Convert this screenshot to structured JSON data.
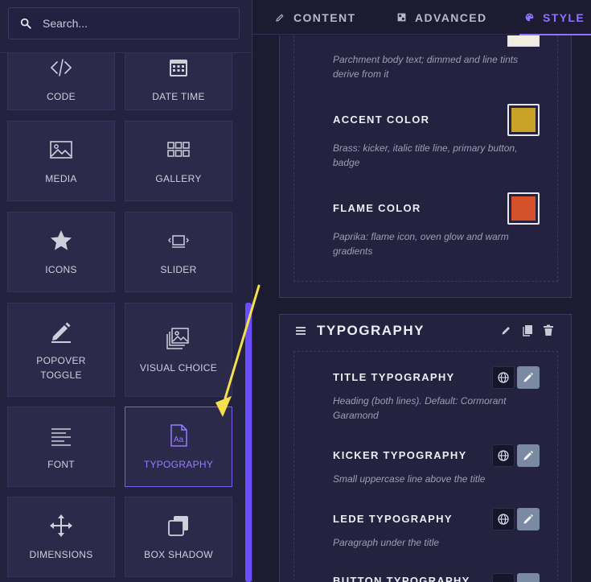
{
  "search": {
    "placeholder": "Search..."
  },
  "widgets": [
    {
      "label": "CODE",
      "icon": "code-icon"
    },
    {
      "label": "DATE TIME",
      "icon": "calendar-icon"
    },
    {
      "label": "MEDIA",
      "icon": "image-icon"
    },
    {
      "label": "GALLERY",
      "icon": "gallery-icon"
    },
    {
      "label": "ICONS",
      "icon": "star-icon"
    },
    {
      "label": "SLIDER",
      "icon": "slider-icon"
    },
    {
      "label": "POPOVER",
      "label2": "TOGGLE",
      "icon": "pencil-icon"
    },
    {
      "label": "VISUAL CHOICE",
      "icon": "images-stack-icon"
    },
    {
      "label": "FONT",
      "icon": "text-lines-icon"
    },
    {
      "label": "TYPOGRAPHY",
      "icon": "typography-icon",
      "active": true
    },
    {
      "label": "DIMENSIONS",
      "icon": "move-arrows-icon"
    },
    {
      "label": "BOX SHADOW",
      "icon": "box-shadow-icon"
    }
  ],
  "tabs": [
    {
      "label": "CONTENT",
      "icon": "pencil-icon"
    },
    {
      "label": "ADVANCED",
      "icon": "grid-icon"
    },
    {
      "label": "STYLE",
      "icon": "palette-icon",
      "active": true
    }
  ],
  "colors_section": {
    "partial_desc": "Parchment body text; dimmed and line tints derive from it",
    "fields": [
      {
        "label": "ACCENT COLOR",
        "desc": "Brass: kicker, italic title line, primary button, badge",
        "color": "#c9a227"
      },
      {
        "label": "FLAME COLOR",
        "desc": "Paprika: flame icon, oven glow and warm gradients",
        "color": "#d4512c"
      }
    ]
  },
  "typography_section": {
    "title": "TYPOGRAPHY",
    "fields": [
      {
        "label": "TITLE TYPOGRAPHY",
        "desc": "Heading (both lines). Default: Cormorant Garamond"
      },
      {
        "label": "KICKER TYPOGRAPHY",
        "desc": "Small uppercase line above the title"
      },
      {
        "label": "LEDE TYPOGRAPHY",
        "desc": "Paragraph under the title"
      },
      {
        "label": "BUTTON TYPOGRAPHY",
        "desc": ""
      }
    ]
  },
  "accent": {
    "purple": "#8f73ff",
    "arrow": "#f4e04d"
  }
}
